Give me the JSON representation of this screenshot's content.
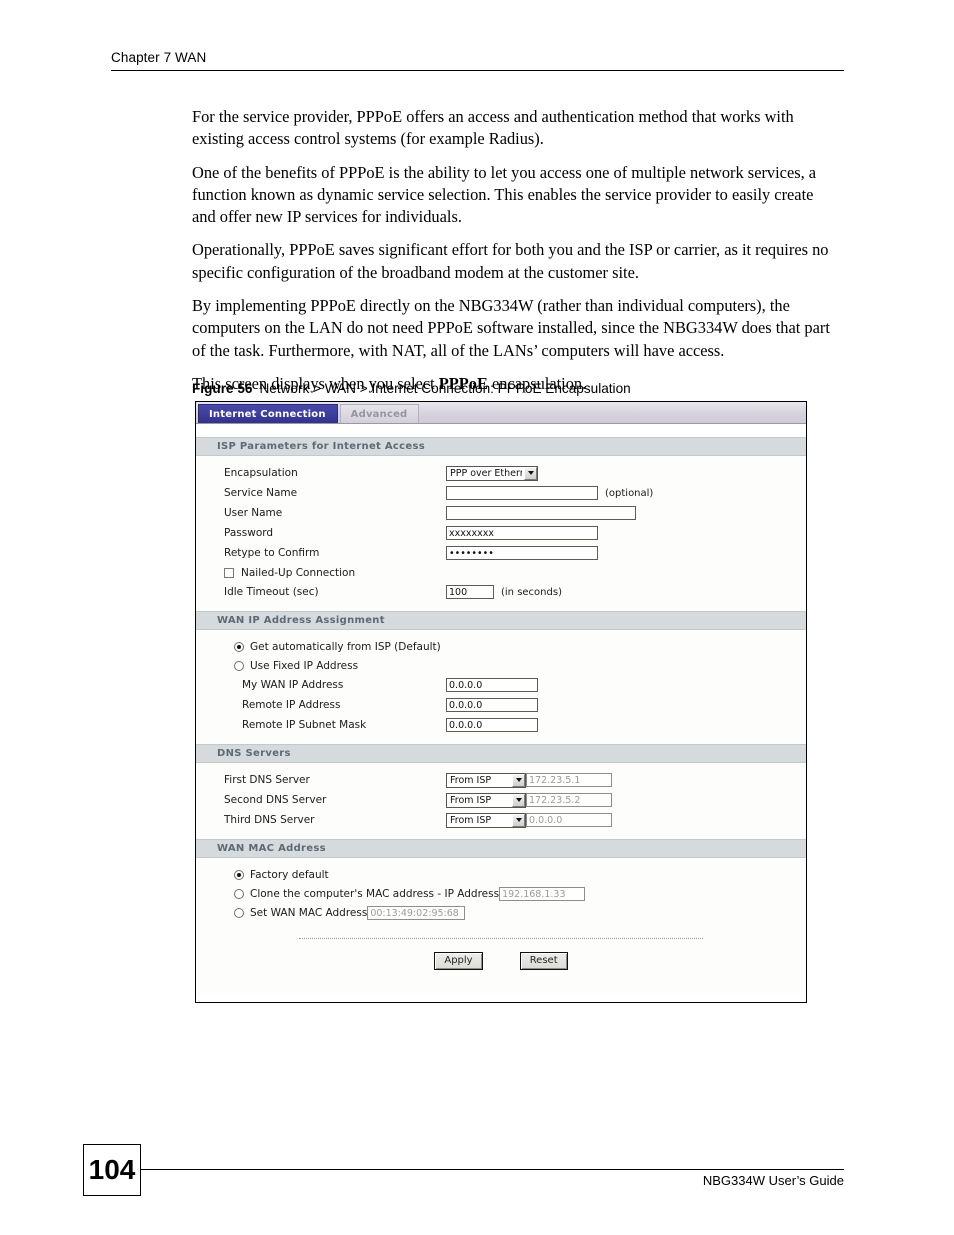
{
  "header": {
    "chapter": "Chapter 7 WAN"
  },
  "prose": {
    "paragraphs": [
      "For the service provider, PPPoE offers an access and authentication method that works with existing access control systems (for example Radius).",
      "One of the benefits of PPPoE is the ability to let you access one of multiple network services, a function known as dynamic service selection. This enables the service provider to easily create and offer new IP services for individuals.",
      "Operationally, PPPoE saves significant effort for both you and the ISP or carrier, as it requires no specific configuration of the broadband modem at the customer site.",
      "By implementing PPPoE directly on the NBG334W (rather than individual computers), the computers on the LAN do not need PPPoE software installed, since the NBG334W does that part of the task. Furthermore, with NAT, all of the LANs’ computers will have access."
    ],
    "final_sentence_start": "This screen displays when you select ",
    "final_sentence_bold": "PPPoE",
    "final_sentence_end": " encapsulation."
  },
  "figure": {
    "label": "Figure 56",
    "caption": "Network > WAN > Internet Connection: PPPoE Encapsulation"
  },
  "screenshot": {
    "tabs": [
      {
        "label": "Internet Connection",
        "active": true
      },
      {
        "label": "Advanced",
        "active": false
      }
    ],
    "isp_section": {
      "title": "ISP Parameters for Internet Access",
      "encapsulation_label": "Encapsulation",
      "encapsulation_value": "PPP over Ethernet",
      "service_name_label": "Service Name",
      "service_name_value": "",
      "service_name_hint": "(optional)",
      "user_name_label": "User Name",
      "user_name_value": "",
      "password_label": "Password",
      "password_value": "xxxxxxxx",
      "retype_label": "Retype to Confirm",
      "retype_value": "••••••••",
      "nailed_up_label": "Nailed-Up Connection",
      "idle_timeout_label": "Idle Timeout (sec)",
      "idle_timeout_value": "100",
      "idle_timeout_hint": "(in seconds)"
    },
    "wan_ip_section": {
      "title": "WAN IP Address Assignment",
      "option_auto": "Get automatically from ISP (Default)",
      "option_fixed": "Use Fixed IP Address",
      "my_wan_ip_label": "My WAN IP Address",
      "my_wan_ip_value": "0.0.0.0",
      "remote_ip_label": "Remote IP Address",
      "remote_ip_value": "0.0.0.0",
      "remote_mask_label": "Remote IP Subnet Mask",
      "remote_mask_value": "0.0.0.0"
    },
    "dns_section": {
      "title": "DNS Servers",
      "rows": [
        {
          "label": "First DNS Server",
          "select": "From ISP",
          "value": "172.23.5.1"
        },
        {
          "label": "Second DNS Server",
          "select": "From ISP",
          "value": "172.23.5.2"
        },
        {
          "label": "Third DNS Server",
          "select": "From ISP",
          "value": "0.0.0.0"
        }
      ]
    },
    "mac_section": {
      "title": "WAN MAC Address",
      "option_factory": "Factory default",
      "option_clone": "Clone the computer's MAC address - IP Address",
      "clone_value": "192.168.1.33",
      "option_set": "Set WAN MAC Address",
      "set_value": "00:13:49:02:95:68"
    },
    "buttons": {
      "apply": "Apply",
      "reset": "Reset"
    }
  },
  "footer": {
    "page_number": "104",
    "guide_title": "NBG334W User’s Guide"
  },
  "colors": {
    "tab_active_bg": "#3b3b98",
    "section_bar_bg": "#d5dbdd",
    "section_bar_text": "#5d6a75"
  }
}
